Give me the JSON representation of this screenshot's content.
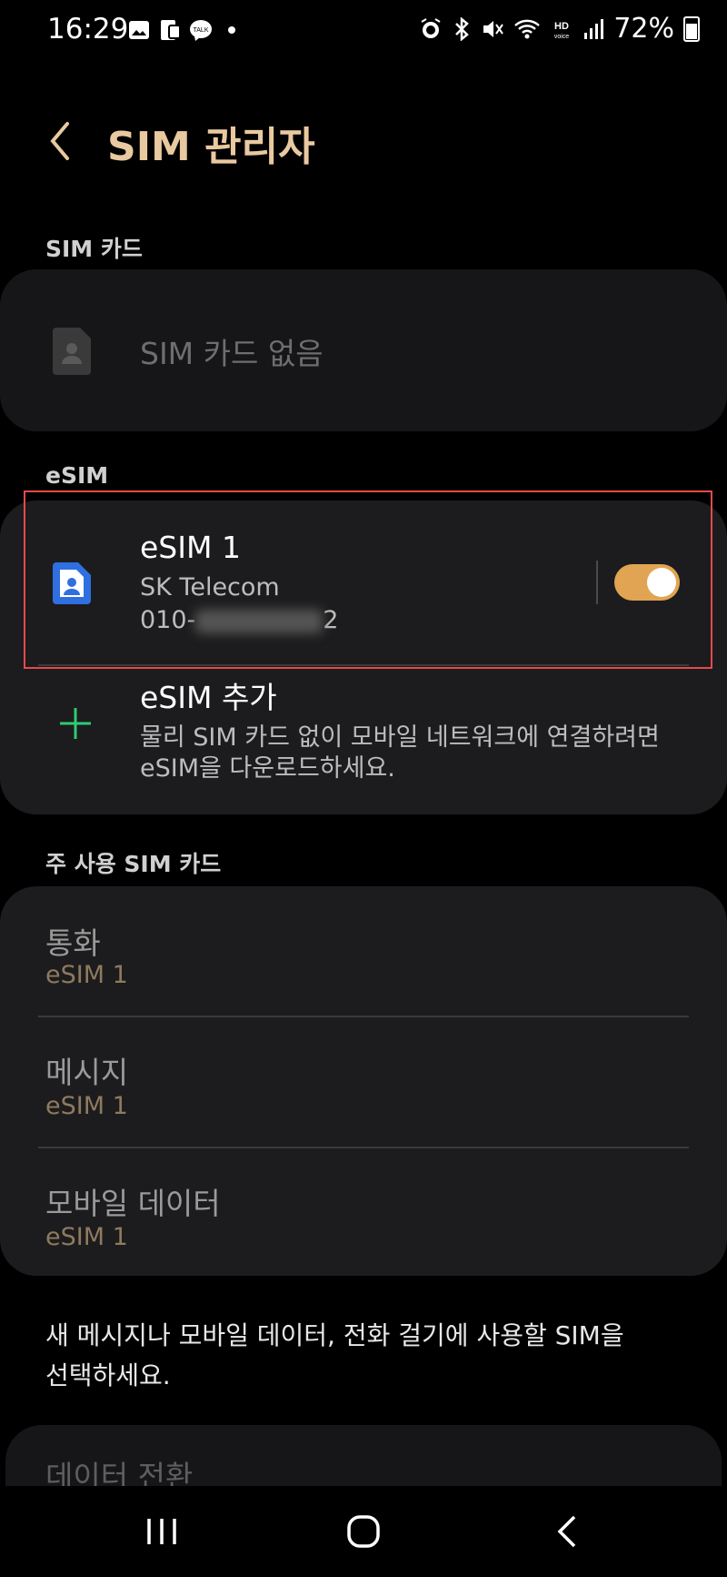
{
  "status_bar": {
    "time": "16:29",
    "battery": "72%",
    "left_icons": [
      "gallery-icon",
      "sim-card-icon",
      "talk-icon",
      "dot-icon"
    ],
    "right_icons": [
      "alarm-icon",
      "bluetooth-icon",
      "mute-icon",
      "wifi-icon",
      "hd-voice-icon",
      "signal-icon",
      "battery-icon"
    ]
  },
  "header": {
    "title": "SIM 관리자"
  },
  "sim_section": {
    "label": "SIM 카드",
    "empty_text": "SIM 카드 없음"
  },
  "esim_section": {
    "label": "eSIM",
    "esim1": {
      "name": "eSIM 1",
      "carrier": "SK Telecom",
      "number_prefix": "010-",
      "number_suffix": "2",
      "enabled": true
    },
    "add": {
      "title": "eSIM 추가",
      "desc_line1": "물리 SIM 카드 없이 모바일 네트워크에 연결하려면",
      "desc_line2": "eSIM을 다운로드하세요."
    }
  },
  "primary_section": {
    "label": "주 사용 SIM 카드",
    "items": [
      {
        "title": "통화",
        "value": "eSIM 1"
      },
      {
        "title": "메시지",
        "value": "eSIM 1"
      },
      {
        "title": "모바일 데이터",
        "value": "eSIM 1"
      }
    ]
  },
  "footer_note": {
    "line1": "새 메시지나 모바일 데이터, 전화 걸기에 사용할 SIM을",
    "line2": "선택하세요."
  },
  "data_switch": {
    "label": "데이터 전환"
  },
  "colors": {
    "accent": "#e9c9a0",
    "toggle_on": "#e0a452",
    "add_plus": "#2ecc71",
    "highlight_border": "#e34a4a"
  }
}
